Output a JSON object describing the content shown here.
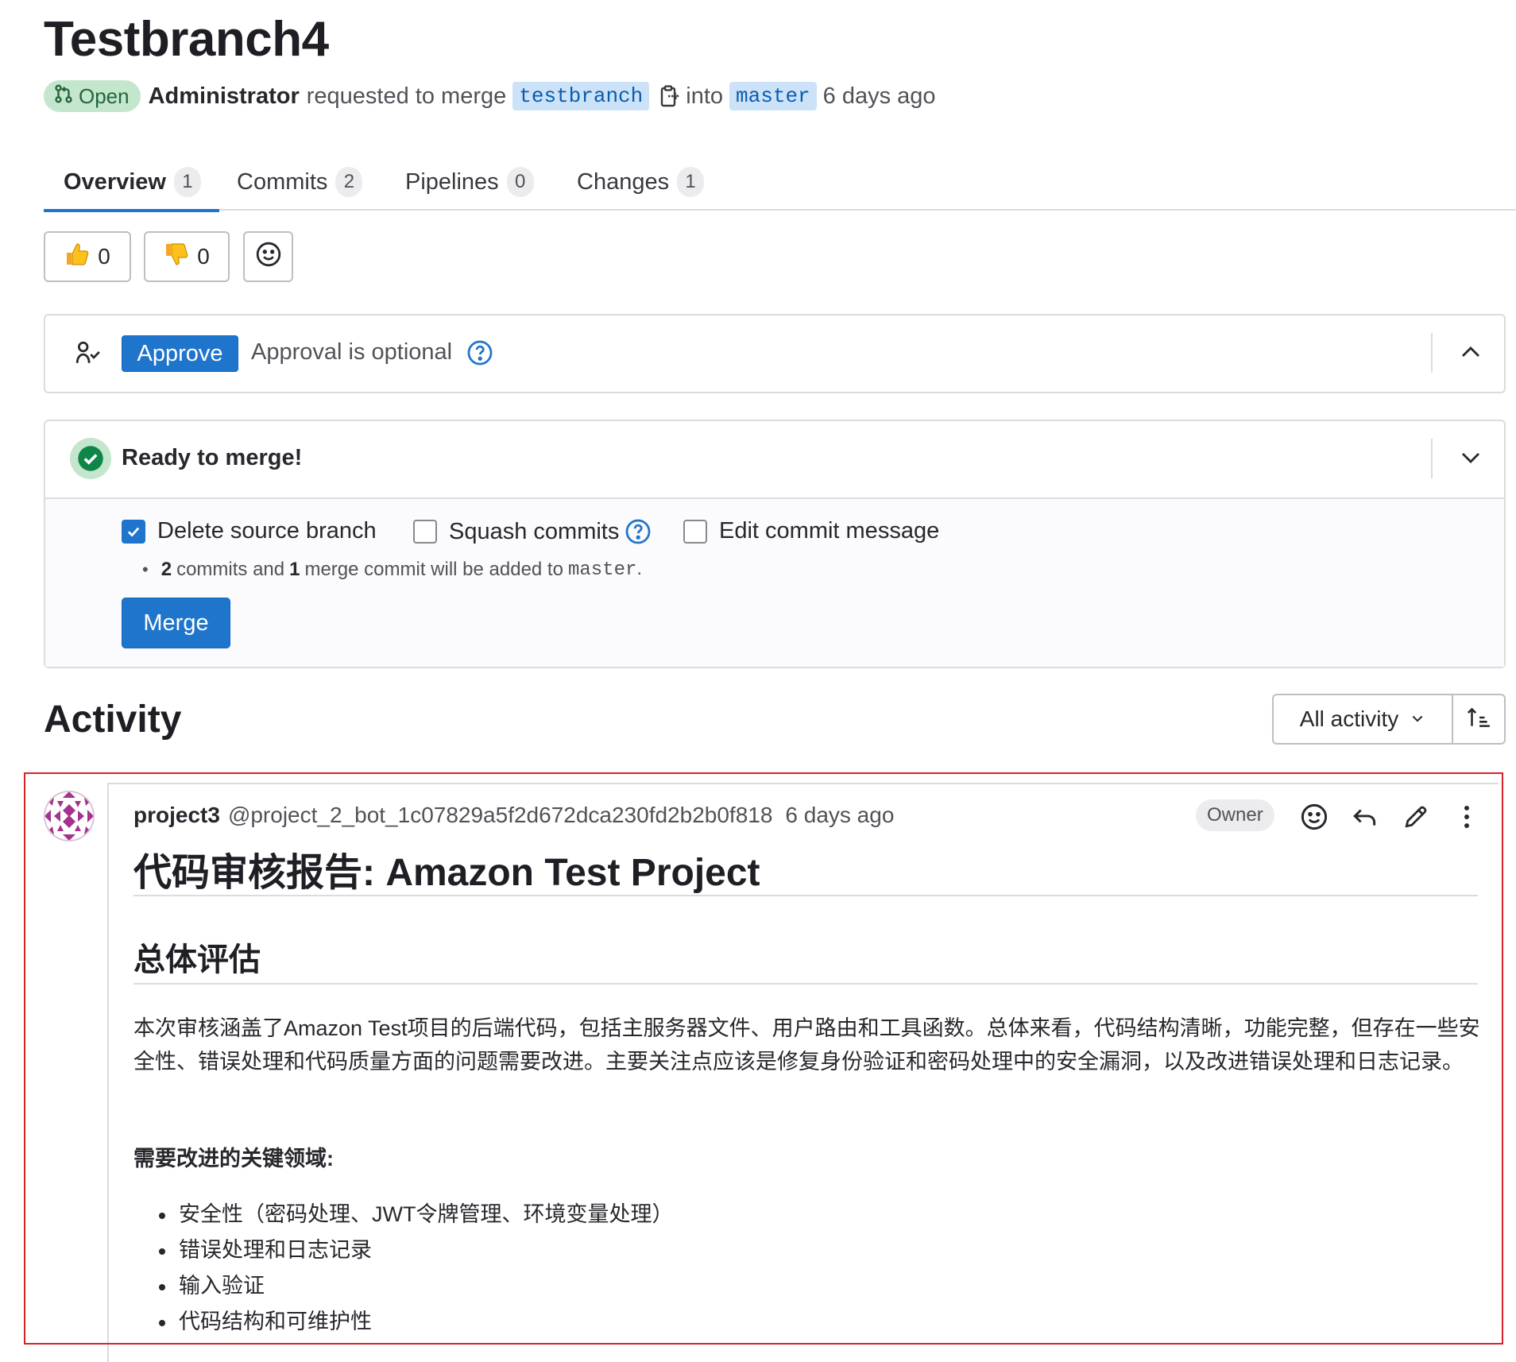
{
  "merge_request": {
    "title": "Testbranch4",
    "status": "Open",
    "author": "Administrator",
    "requested_text": "requested to merge",
    "source_branch": "testbranch",
    "into_text": "into",
    "target_branch": "master",
    "time": "6 days ago"
  },
  "tabs": [
    {
      "label": "Overview",
      "count": "1",
      "active": true
    },
    {
      "label": "Commits",
      "count": "2"
    },
    {
      "label": "Pipelines",
      "count": "0"
    },
    {
      "label": "Changes",
      "count": "1"
    }
  ],
  "awards": {
    "thumbs_up": "0",
    "thumbs_down": "0"
  },
  "approval": {
    "approve_label": "Approve",
    "status_text": "Approval is optional"
  },
  "merge": {
    "status": "Ready to merge!",
    "delete_source_label": "Delete source branch",
    "delete_source_checked": true,
    "squash_label": "Squash commits",
    "squash_checked": false,
    "edit_message_label": "Edit commit message",
    "edit_message_checked": false,
    "commits_count": "2",
    "commits_text": "commits and",
    "merge_commits_count": "1",
    "merge_commit_text": "merge commit will be added to",
    "target_branch": "master",
    "period": ".",
    "merge_label": "Merge"
  },
  "activity": {
    "heading": "Activity",
    "filter_label": "All activity"
  },
  "note": {
    "author": "project3",
    "username": "@project_2_bot_1c07829a5f2d672dca230fd2b2b0f818",
    "time": "6 days ago",
    "role_badge": "Owner",
    "title": "代码审核报告: Amazon Test Project",
    "section_heading": "总体评估",
    "paragraph": "本次审核涵盖了Amazon Test项目的后端代码，包括主服务器文件、用户路由和工具函数。总体来看，代码结构清晰，功能完整，但存在一些安全性、错误处理和代码质量方面的问题需要改进。主要关注点应该是修复身份验证和密码处理中的安全漏洞，以及改进错误处理和日志记录。",
    "key_areas_label": "需要改进的关键领域:",
    "key_areas": [
      "安全性（密码处理、JWT令牌管理、环境变量处理）",
      "错误处理和日志记录",
      "输入验证",
      "代码结构和可维护性"
    ]
  },
  "colors": {
    "primary": "#1f75cb",
    "open_badge_bg": "#c3e6cd",
    "open_badge_text": "#24663b",
    "highlight_border": "#d8222a"
  },
  "icons": {
    "status": "merge-request-icon",
    "copy": "copy-branch-icon",
    "thumbs_up": "thumbs-up-emoji",
    "thumbs_down": "thumbs-down-emoji",
    "emoji_picker": "smiley-icon",
    "approvers": "approvers-icon",
    "help": "question-circle-icon",
    "collapse": "chevron-up-icon",
    "expand": "chevron-down-icon",
    "success": "check-circle-icon",
    "sort": "sort-ascending-icon",
    "reply": "reply-icon",
    "edit": "pencil-icon",
    "more": "more-vertical-icon"
  }
}
